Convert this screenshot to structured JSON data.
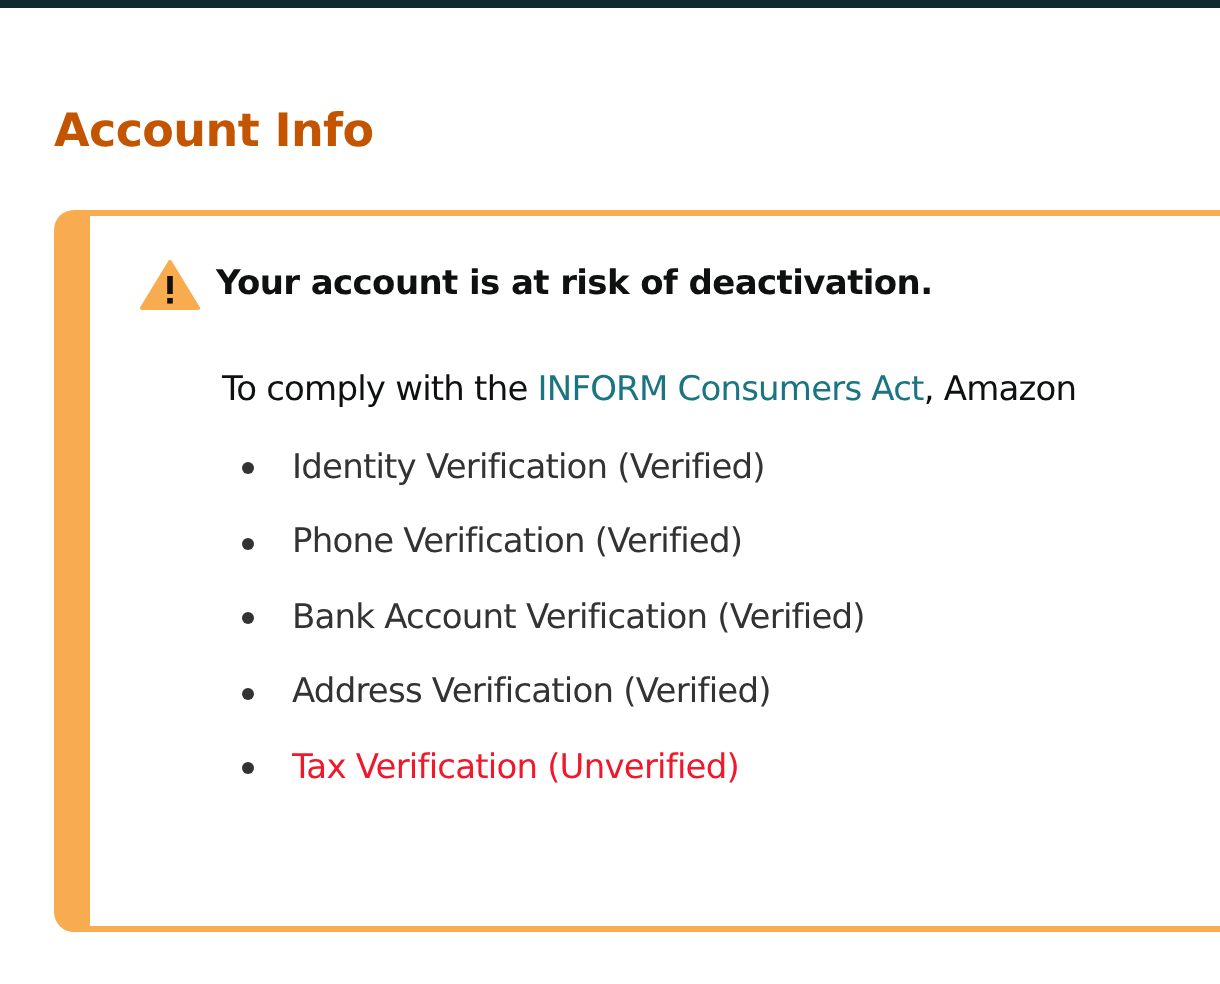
{
  "heading": "Account Info",
  "alert": {
    "title": "Your account is at risk of deactivation.",
    "message": {
      "before": "To comply with the ",
      "link": "INFORM Consumers Act",
      "after": ", Amazon"
    },
    "checks": [
      {
        "label": "Identity Verification (Verified)",
        "verified": true
      },
      {
        "label": "Phone Verification (Verified)",
        "verified": true
      },
      {
        "label": "Bank Account Verification (Verified)",
        "verified": true
      },
      {
        "label": "Address Verification (Verified)",
        "verified": true
      },
      {
        "label": "Tax Verification (Unverified)",
        "verified": false
      }
    ]
  }
}
